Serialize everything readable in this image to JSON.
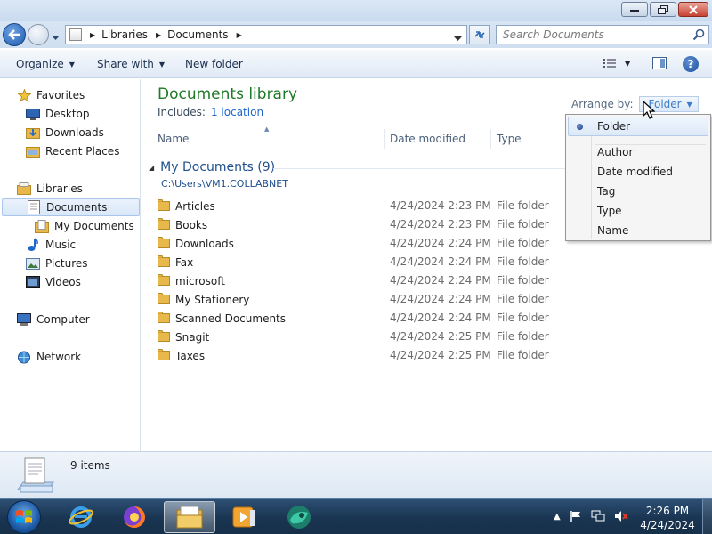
{
  "address": {
    "crumbs": [
      "Libraries",
      "Documents"
    ],
    "search_placeholder": "Search Documents"
  },
  "toolbar": {
    "organize": "Organize",
    "share_with": "Share with",
    "new_folder": "New folder"
  },
  "nav": {
    "favorites": "Favorites",
    "desktop": "Desktop",
    "downloads": "Downloads",
    "recent_places": "Recent Places",
    "libraries": "Libraries",
    "documents": "Documents",
    "my_documents": "My Documents",
    "music": "Music",
    "pictures": "Pictures",
    "videos": "Videos",
    "computer": "Computer",
    "network": "Network"
  },
  "main": {
    "title": "Documents library",
    "includes_label": "Includes:",
    "includes_link": "1 location",
    "arrange_label": "Arrange by:",
    "arrange_value": "Folder",
    "columns": {
      "name": "Name",
      "date_modified": "Date modified",
      "type": "Type"
    },
    "group": {
      "title": "My Documents (9)",
      "path": "C:\\Users\\VM1.COLLABNET"
    },
    "files": [
      {
        "name": "Articles",
        "date": "4/24/2024 2:23 PM",
        "type": "File folder"
      },
      {
        "name": "Books",
        "date": "4/24/2024 2:23 PM",
        "type": "File folder"
      },
      {
        "name": "Downloads",
        "date": "4/24/2024 2:24 PM",
        "type": "File folder"
      },
      {
        "name": "Fax",
        "date": "4/24/2024 2:24 PM",
        "type": "File folder"
      },
      {
        "name": "microsoft",
        "date": "4/24/2024 2:24 PM",
        "type": "File folder"
      },
      {
        "name": "My Stationery",
        "date": "4/24/2024 2:24 PM",
        "type": "File folder"
      },
      {
        "name": "Scanned Documents",
        "date": "4/24/2024 2:24 PM",
        "type": "File folder"
      },
      {
        "name": "Snagit",
        "date": "4/24/2024 2:25 PM",
        "type": "File folder"
      },
      {
        "name": "Taxes",
        "date": "4/24/2024 2:25 PM",
        "type": "File folder"
      }
    ]
  },
  "arrange_menu": {
    "items": [
      "Folder",
      "Author",
      "Date modified",
      "Tag",
      "Type",
      "Name"
    ],
    "checked": "Folder"
  },
  "status": {
    "count": "9 items"
  },
  "taskbar": {
    "time": "2:26 PM",
    "date": "4/24/2024"
  },
  "colors": {
    "library_title": "#1e7a26",
    "link": "#1f66cc",
    "folder": "#e8b84a"
  },
  "icons": {
    "back": "back-arrow-icon",
    "forward": "forward-arrow-icon",
    "refresh": "refresh-icon",
    "search": "search-icon",
    "help": "help-icon",
    "folder": "folder-icon"
  }
}
